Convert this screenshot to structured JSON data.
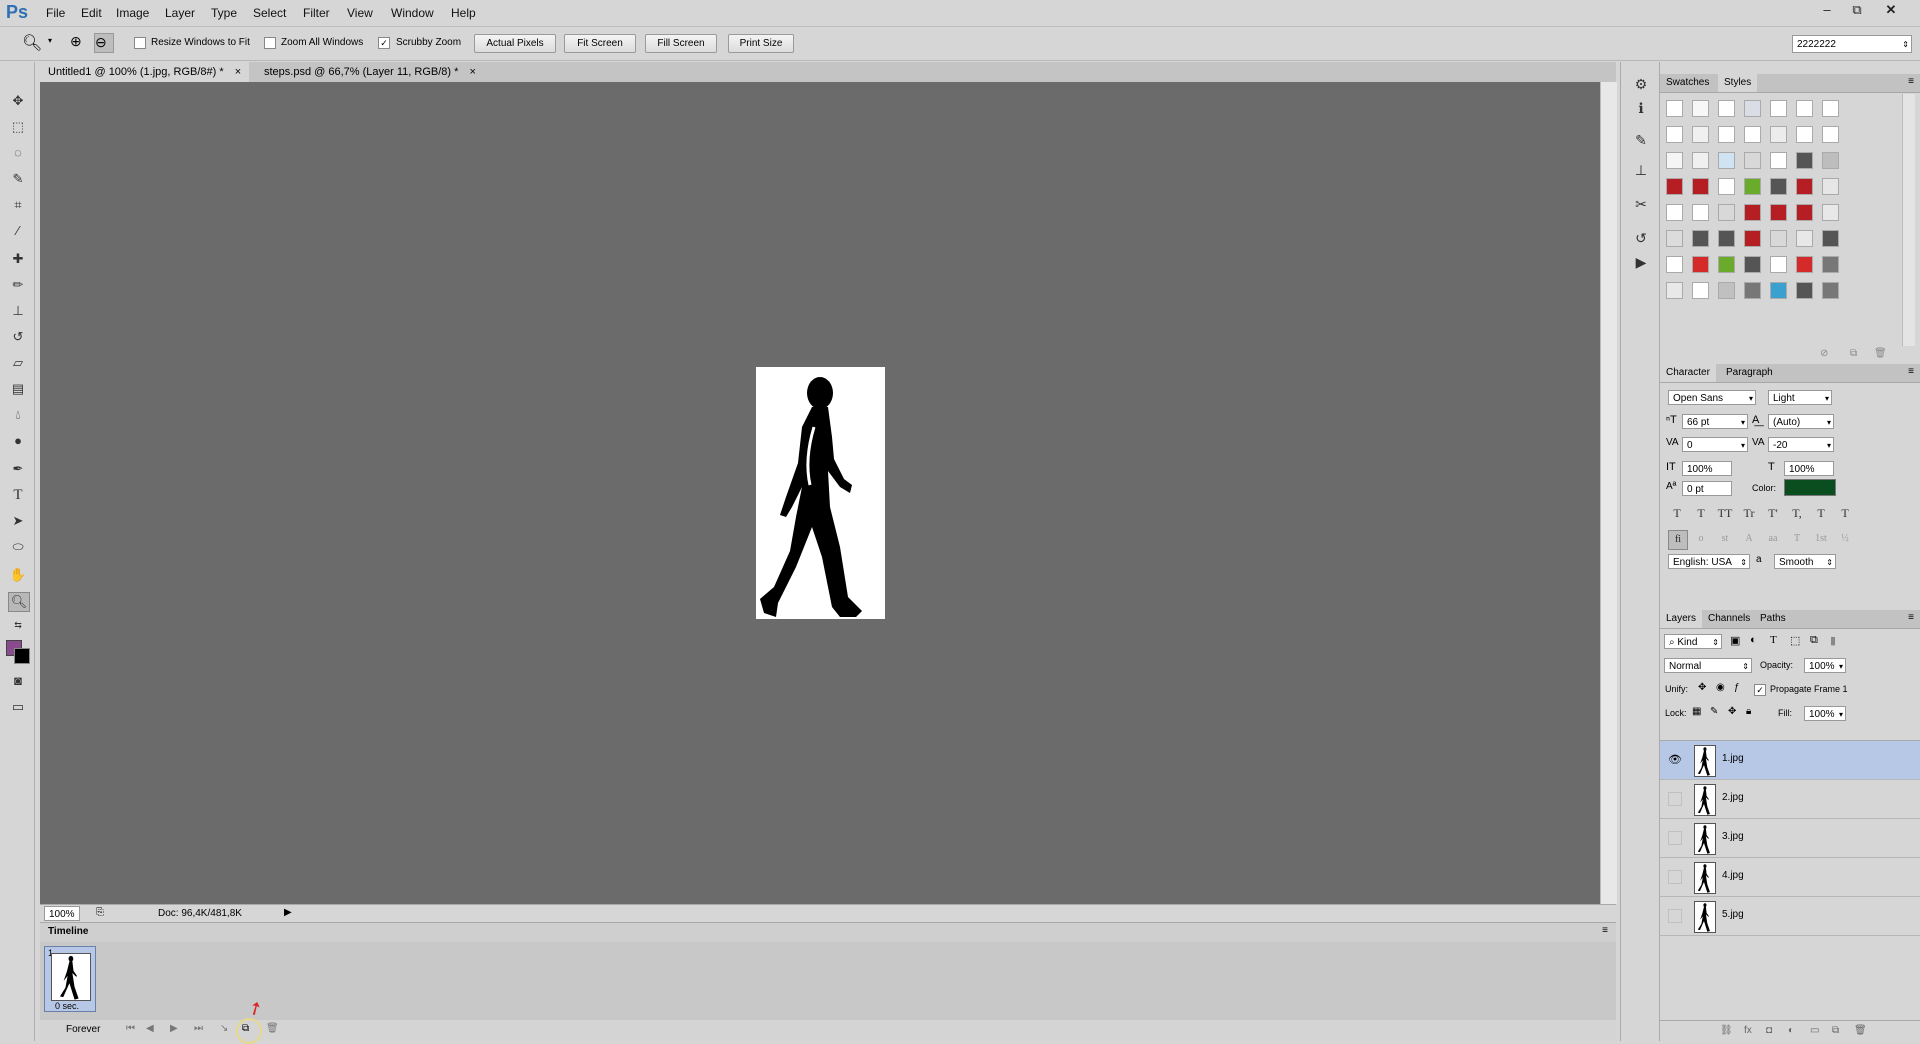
{
  "app": {
    "logo": "Ps"
  },
  "menu": [
    "File",
    "Edit",
    "Image",
    "Layer",
    "Type",
    "Select",
    "Filter",
    "View",
    "Window",
    "Help"
  ],
  "window_controls": [
    "–",
    "⧉",
    "✕"
  ],
  "options": {
    "resize_windows": "Resize Windows to Fit",
    "zoom_all": "Zoom All Windows",
    "scrubby": "Scrubby Zoom",
    "buttons": [
      "Actual Pixels",
      "Fit Screen",
      "Fill Screen",
      "Print Size"
    ],
    "workspace": "2222222"
  },
  "tabs": [
    {
      "label": "Untitled1 @ 100% (1.jpg, RGB/8#) *",
      "close": "×"
    },
    {
      "label": "steps.psd @ 66,7% (Layer 11, RGB/8) *",
      "close": "×"
    }
  ],
  "status": {
    "zoom": "100%",
    "doc": "Doc: 96,4K/481,8K"
  },
  "timeline": {
    "title": "Timeline",
    "frame_number": "1",
    "frame_delay": "0 sec.",
    "loop": "Forever"
  },
  "swatches_panel": {
    "tabs": [
      "Swatches",
      "Styles"
    ]
  },
  "styles_colors": [
    [
      "#ffffff",
      "#f7f7f7",
      "#ffffff",
      "#dadde6",
      "#ffffff",
      "#ffffff",
      "#ffffff"
    ],
    [
      "#ffffff",
      "#f0f0f0",
      "#ffffff",
      "#ffffff",
      "#ececec",
      "#ffffff",
      "#ffffff"
    ],
    [
      "#f5f5f5",
      "#f0f0f0",
      "#cfe3f3",
      "#d8d8d8",
      "#ffffff",
      "#555555",
      "#bdbdbd"
    ],
    [
      "#b51e23",
      "#b51e23",
      "#ffffff",
      "#6bab2c",
      "#555555",
      "#b51e23",
      "#e6e6e6"
    ],
    [
      "#ffffff",
      "#ffffff",
      "#d8d8d8",
      "#b51e23",
      "#b51e23",
      "#b51e23",
      "#e8e8e8"
    ],
    [
      "#dcdcdc",
      "#555555",
      "#555555",
      "#b51e23",
      "#d8d8d8",
      "#e8e8e8",
      "#555555"
    ],
    [
      "#ffffff",
      "#d42a2a",
      "#6bab2c",
      "#555555",
      "#ffffff",
      "#d42a2a",
      "#777777"
    ],
    [
      "#e8e8e8",
      "#ffffff",
      "#c0c0c0",
      "#777777",
      "#3aa0d0",
      "#555555",
      "#777777"
    ]
  ],
  "character_panel": {
    "tabs": [
      "Character",
      "Paragraph"
    ],
    "font": "Open Sans",
    "style": "Light",
    "size": "66 pt",
    "leading": "(Auto)",
    "kerning": "0",
    "tracking": "-20",
    "vscale": "100%",
    "hscale": "100%",
    "baseline": "0 pt",
    "color_label": "Color:",
    "color": "#0a4d1e",
    "language": "English: USA",
    "aa": "Smooth",
    "aa_icon": "a",
    "type_buttons": [
      "T",
      "T",
      "TT",
      "Tr",
      "T'",
      "T,",
      "T",
      "T"
    ],
    "ot_buttons": [
      "fi",
      "o",
      "st",
      "A",
      "aa",
      "T",
      "1st",
      "½"
    ]
  },
  "layers_panel": {
    "tabs": [
      "Layers",
      "Channels",
      "Paths"
    ],
    "filter": "Kind",
    "blend": "Normal",
    "opacity_label": "Opacity:",
    "opacity": "100%",
    "unify_label": "Unify:",
    "propagate": "Propagate Frame 1",
    "lock_label": "Lock:",
    "fill_label": "Fill:",
    "fill": "100%",
    "layers": [
      "1.jpg",
      "2.jpg",
      "3.jpg",
      "4.jpg",
      "5.jpg"
    ],
    "selected_color": "#b7c8e6"
  },
  "tool_color": {
    "foreground": "#8a4a8e",
    "background": "#000000"
  }
}
